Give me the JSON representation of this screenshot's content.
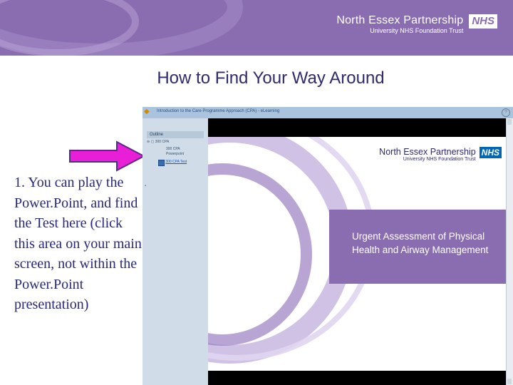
{
  "header": {
    "org_name": "North Essex Partnership",
    "org_sub": "University NHS Foundation Trust",
    "nhs_badge": "NHS"
  },
  "slide": {
    "title": "How to Find Your Way Around",
    "caption": "1. You can play the Power.Point, and find the Test here (click this area on your main screen, not within the Power.Point presentation)"
  },
  "app": {
    "window_title": "Introduction to the Care Programme Approach (CPA) - eLearning",
    "outline_label": "Outline",
    "tree": {
      "root": "300 CPA",
      "child1_line1": "300 CPA",
      "child1_line2": "Powerpoint",
      "child2": "300 CPA Test"
    },
    "slide_logo_main": "North Essex Partnership",
    "slide_logo_sub": "University NHS Foundation Trust",
    "slide_nhs": "NHS",
    "slide_heading_line1": "Urgent Assessment of Physical",
    "slide_heading_line2": "Health and Airway Management"
  },
  "colors": {
    "brand_purple": "#8a6db0",
    "title_navy": "#2e2a6e",
    "arrow_magenta": "#e81fd6",
    "nhs_blue": "#0065b3"
  },
  "icons": {
    "app": "app-icon",
    "help": "help-icon",
    "arrow": "pointer-arrow-icon"
  }
}
